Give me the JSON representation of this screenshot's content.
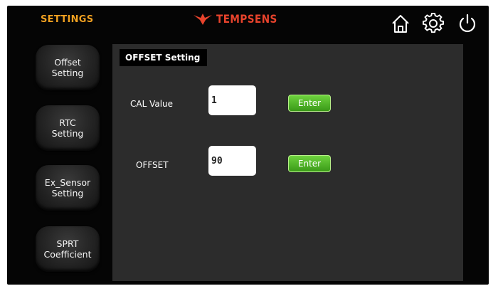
{
  "header": {
    "title": "SETTINGS",
    "brand": "TEMPSENS",
    "icons": [
      "home-icon",
      "gear-icon",
      "power-icon"
    ]
  },
  "sidebar": {
    "items": [
      {
        "label": "Offset\nSetting"
      },
      {
        "label": "RTC\nSetting"
      },
      {
        "label": "Ex_Sensor\nSetting"
      },
      {
        "label": "SPRT\nCoefficient"
      }
    ]
  },
  "panel": {
    "tab_label": "OFFSET Setting",
    "rows": [
      {
        "label": "CAL Value",
        "value": "1",
        "button": "Enter"
      },
      {
        "label": "OFFSET",
        "value": "90",
        "button": "Enter"
      }
    ]
  },
  "colors": {
    "title": "#f0a020",
    "brand": "#e8432c",
    "enter_green": "#4cb324",
    "screen_bg": "#050505",
    "panel_bg": "#2c2c2c"
  }
}
